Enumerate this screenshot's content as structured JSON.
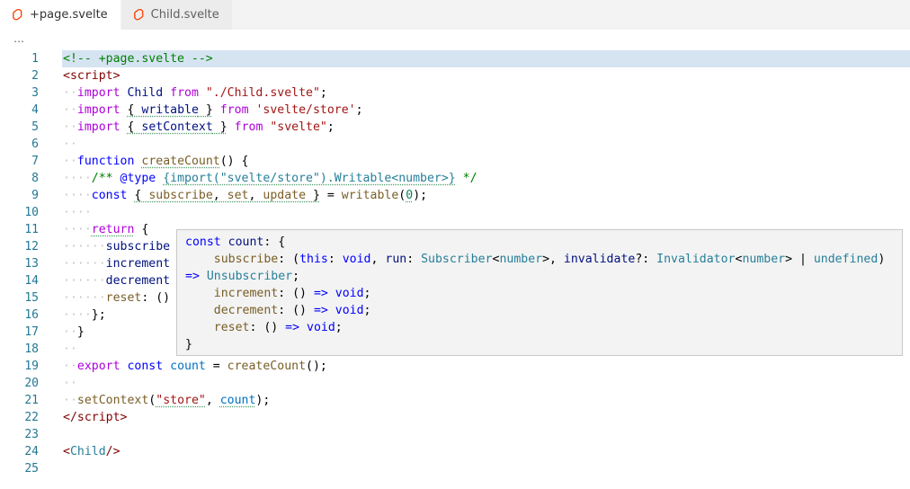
{
  "tabs": [
    {
      "label": "+page.svelte",
      "active": true,
      "icon": "svelte-icon"
    },
    {
      "label": "Child.svelte",
      "active": false,
      "icon": "svelte-icon"
    }
  ],
  "breadcrumb": "…",
  "line_numbers": [
    "1",
    "2",
    "3",
    "4",
    "5",
    "6",
    "7",
    "8",
    "9",
    "10",
    "11",
    "12",
    "13",
    "14",
    "15",
    "16",
    "17",
    "18",
    "19",
    "20",
    "21",
    "22",
    "23",
    "24",
    "25"
  ],
  "code": {
    "l1": "<!-- +page.svelte -->",
    "l2_open": "<",
    "l2_tag": "script",
    "l2_close": ">",
    "import_kw": "import",
    "from_kw": "from",
    "l3_name": "Child",
    "l3_src": "\"./Child.svelte\"",
    "l4_name": "writable",
    "l4_src": "'svelte/store'",
    "l5_name": "setContext",
    "l5_src": "\"svelte\"",
    "l7_kw": "function",
    "l7_fn": "createCount",
    "l8_doc_start": "/** ",
    "l8_tag": "@type",
    "l8_type": "{import(\"svelte/store\").Writable<number>}",
    "l8_doc_end": " */",
    "const_kw": "const",
    "l9_vars": [
      "subscribe",
      "set",
      "update"
    ],
    "l9_fn": "writable",
    "l9_num": "0",
    "l11_kw": "return",
    "l12_prop": "subscribe",
    "l13_prop": "increment",
    "l14_prop": "decrement",
    "l15_prop": "reset",
    "l19_kw": "export",
    "l19_var": "count",
    "l19_fn": "createCount",
    "l21_fn": "setContext",
    "l21_str": "\"store\"",
    "l21_var": "count",
    "l22_tag": "script",
    "l24_tag": "Child"
  },
  "hover": {
    "line1_kw": "const",
    "line1_name": "count",
    "subscribe_name": "subscribe",
    "this_kw": "this",
    "void_kw": "void",
    "run_name": "run",
    "subscriber_type": "Subscriber",
    "number_type": "number",
    "invalidate_name": "invalidate",
    "invalidator_type": "Invalidator",
    "undefined_kw": "undefined",
    "unsubscriber_type": "Unsubscriber",
    "increment_name": "increment",
    "decrement_name": "decrement",
    "reset_name": "reset"
  },
  "colors": {
    "active_line": "#d6e4f2",
    "line_number": "#237893",
    "svelte_brand": "#ff3e00"
  }
}
